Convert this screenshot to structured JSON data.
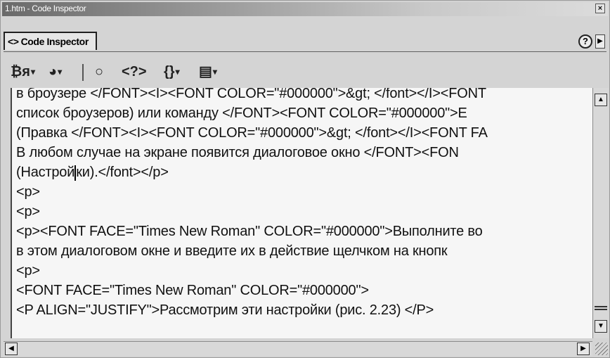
{
  "window": {
    "title": "1.htm - Code Inspector"
  },
  "tab": {
    "icon": "<>",
    "label": "Code Inspector"
  },
  "titlebar": {
    "close_glyph": "×"
  },
  "header": {
    "help_glyph": "?",
    "menu_glyph": "▶"
  },
  "toolbar": {
    "items": [
      {
        "icon": "file-management-icon",
        "glyph": "₿ᴙ"
      },
      {
        "icon": "preview-in-browser-icon",
        "glyph": "◕"
      },
      {
        "icon": "refresh-icon",
        "glyph": "○"
      },
      {
        "icon": "code-navigation-icon",
        "glyph": "<?>"
      },
      {
        "icon": "code-brackets-icon",
        "glyph": "{}"
      },
      {
        "icon": "view-options-icon",
        "glyph": "▤"
      }
    ],
    "dropdown_glyph": "▾"
  },
  "code": {
    "lines": [
      "в броузере </FONT><I><FONT COLOR=\"#000000\">&gt; </font></I><FONT",
      "список броузеров) или команду </FONT><FONT COLOR=\"#000000\">E",
      "(Правка </FONT><I><FONT COLOR=\"#000000\">&gt; </font></I><FONT FA",
      "В любом случае на экране появится диалоговое окно </FONT><FON",
      "(Настрой",
      "<p>",
      "<p>",
      "<p><FONT FACE=\"Times New Roman\" COLOR=\"#000000\">Выполните во",
      " в этом диалоговом окне и введите их в действие щелчком на кнопк",
      "<p>",
      "<FONT FACE=\"Times New Roman\" COLOR=\"#000000\">",
      "<P ALIGN=\"JUSTIFY\">Рассмотрим эти настройки (рис. 2.23) </P>"
    ],
    "line4_after_cursor": "ки).</font></p>"
  },
  "scroll": {
    "up": "▲",
    "down": "▼",
    "left": "◀",
    "right": "▶"
  },
  "colors": {
    "editor_bg": "#f6f6f6",
    "text": "#111111",
    "chrome": "#d4d4d4"
  }
}
